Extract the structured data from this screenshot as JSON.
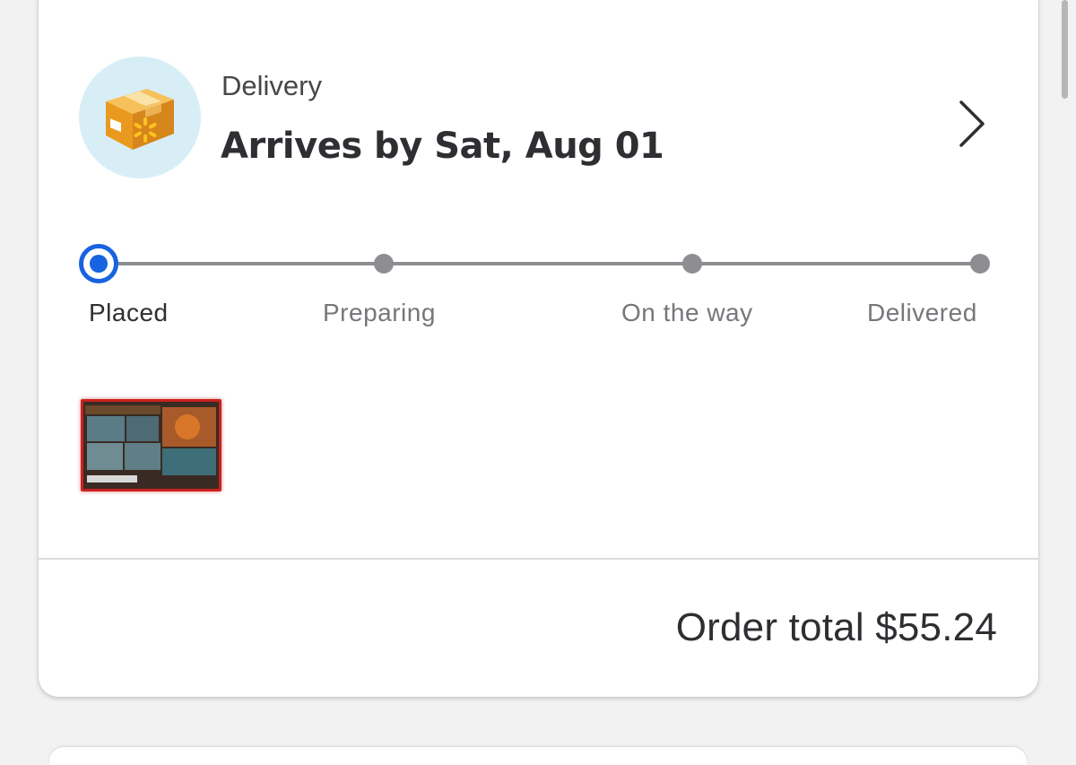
{
  "order": {
    "fulfillment_type": "Delivery",
    "arrival": "Arrives by Sat, Aug 01",
    "total_text": "Order total $55.24"
  },
  "tracker": {
    "steps": [
      {
        "label": "Placed",
        "state": "current"
      },
      {
        "label": "Preparing",
        "state": "pending"
      },
      {
        "label": "On the way",
        "state": "pending"
      },
      {
        "label": "Delivered",
        "state": "pending"
      }
    ]
  },
  "icons": {
    "header": "package-box-icon",
    "details": "chevron-right-icon"
  },
  "colors": {
    "accent": "#1763e0",
    "pending": "#8d8e92",
    "box": "#f0a32a",
    "avatar_bg": "#d8eef7"
  }
}
